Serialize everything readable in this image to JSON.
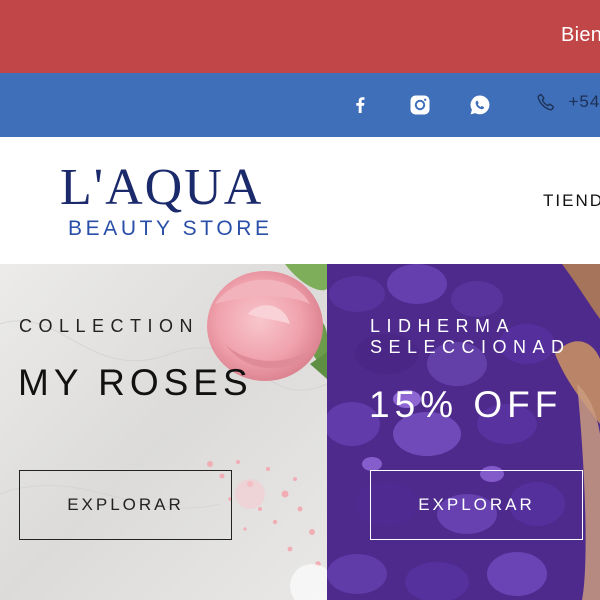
{
  "announcement": {
    "text": "Bien"
  },
  "social": {
    "icons": [
      "facebook-icon",
      "instagram-icon",
      "whatsapp-icon"
    ],
    "phone_icon": "phone-icon",
    "phone": "+54"
  },
  "logo": {
    "main": "L'AQUA",
    "sub": "BEAUTY STORE"
  },
  "nav": {
    "items": [
      "TIEND"
    ]
  },
  "banners": [
    {
      "overline": "COLLECTION",
      "title": "MY ROSES",
      "button": "EXPLORAR"
    },
    {
      "overline": "LIDHERMA\nSELECCIONAD",
      "title": "15% OFF",
      "button": "EXPLORAR"
    }
  ],
  "colors": {
    "announcement_bg": "#c14647",
    "social_bg": "#3e6fb8",
    "logo_navy": "#1b2a6b",
    "logo_blue": "#2a4fa8",
    "banner_left_bg": "#e4e3e2",
    "banner_right_bg": "#4d2a8c"
  }
}
